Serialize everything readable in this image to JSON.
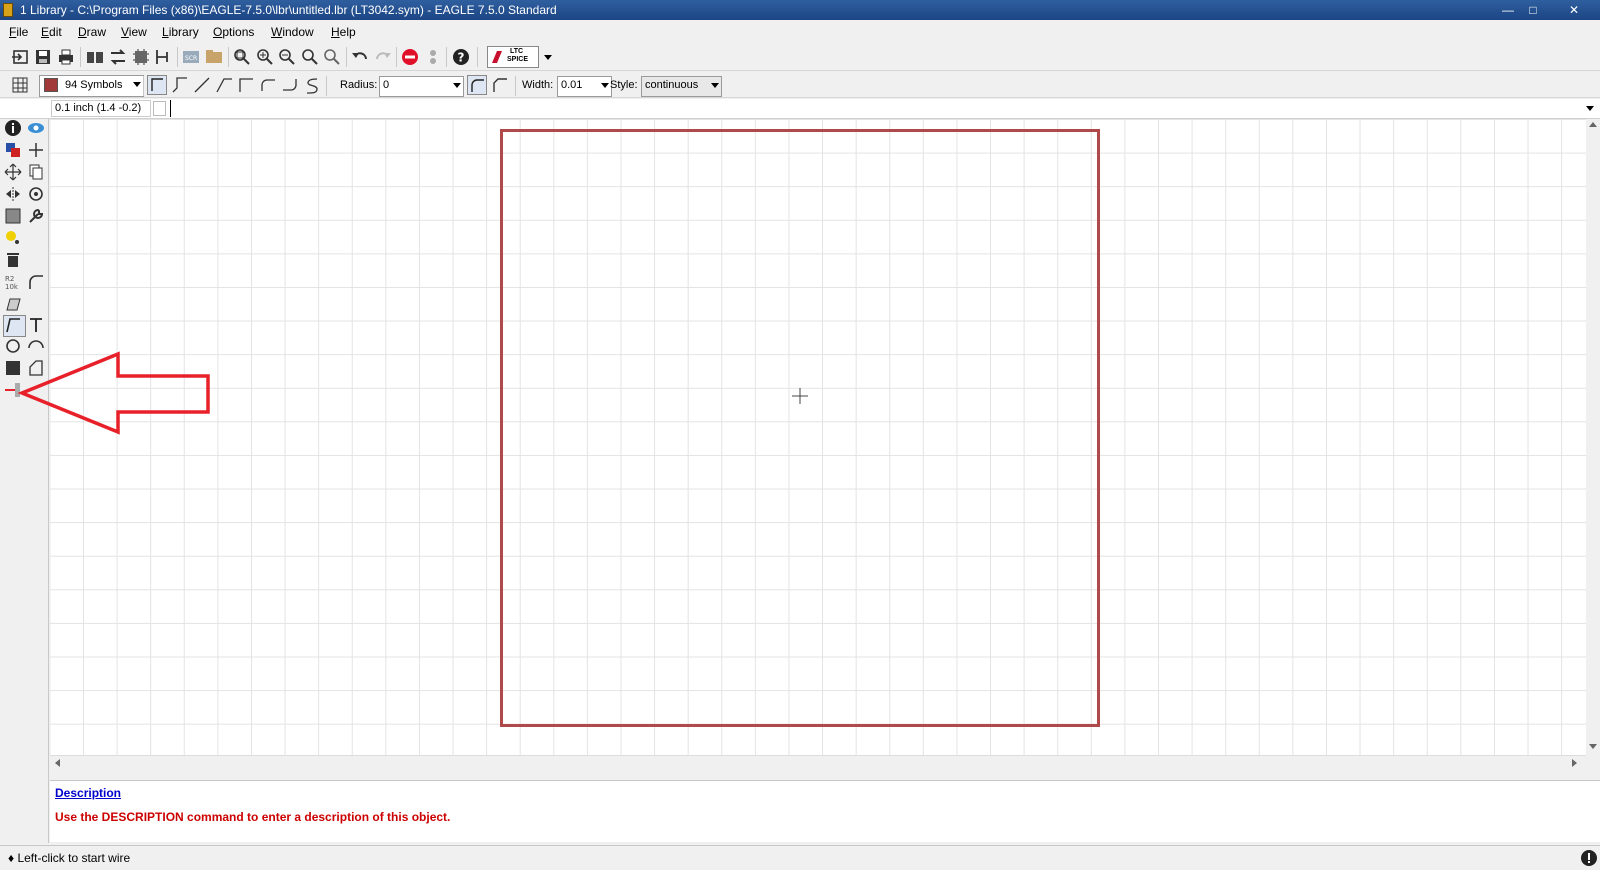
{
  "window": {
    "title": "1 Library - C:\\Program Files (x86)\\EAGLE-7.5.0\\lbr\\untitled.lbr (LT3042.sym) - EAGLE 7.5.0 Standard",
    "min": "—",
    "max": "□",
    "close": "✕"
  },
  "menu": [
    "File",
    "Edit",
    "Draw",
    "View",
    "Library",
    "Options",
    "Window",
    "Help"
  ],
  "toolbar": {
    "ltspice_label_1": "LTC",
    "ltspice_label_2": "SPICE"
  },
  "params": {
    "layer": "94 Symbols",
    "layer_color": "#a33a3a",
    "radius_label": "Radius:",
    "radius_value": "0",
    "width_label": "Width:",
    "width_value": "0.01",
    "style_label": "Style:",
    "style_value": "continuous"
  },
  "command": {
    "grid_readout": "0.1 inch (1.4 -0.2)",
    "input_value": ""
  },
  "canvas": {
    "frame_color": "#b04a4a",
    "annotation_color": "#e8202a"
  },
  "description": {
    "title": "Description",
    "text": "Use the DESCRIPTION command to enter a description of this object."
  },
  "status": {
    "text": "♦ Left-click to start wire",
    "icon": "info-icon"
  }
}
